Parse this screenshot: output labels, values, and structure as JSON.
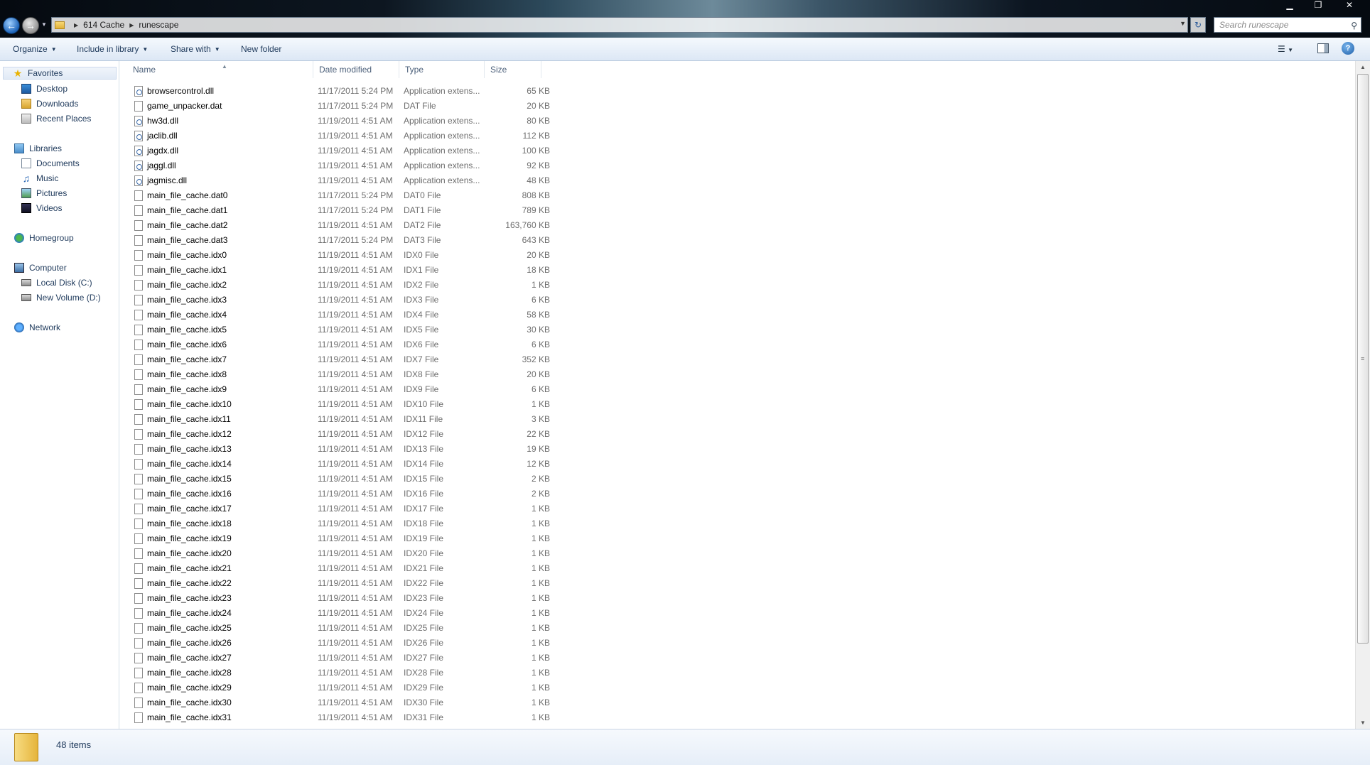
{
  "window": {
    "minimize_glyph": "▁",
    "restore_glyph": "❐",
    "close_glyph": "✕"
  },
  "address": {
    "crumbs": [
      "614 Cache",
      "runescape"
    ]
  },
  "search": {
    "placeholder": "Search runescape"
  },
  "toolbar": {
    "organize": "Organize",
    "include_in_library": "Include in library",
    "share_with": "Share with",
    "new_folder": "New folder"
  },
  "nav": {
    "favorites": "Favorites",
    "desktop": "Desktop",
    "downloads": "Downloads",
    "recent_places": "Recent Places",
    "libraries": "Libraries",
    "documents": "Documents",
    "music": "Music",
    "pictures": "Pictures",
    "videos": "Videos",
    "homegroup": "Homegroup",
    "computer": "Computer",
    "local_disk": "Local Disk (C:)",
    "new_volume": "New Volume (D:)",
    "network": "Network"
  },
  "columns": {
    "name": "Name",
    "date_modified": "Date modified",
    "type": "Type",
    "size": "Size"
  },
  "files": [
    {
      "name": "browsercontrol.dll",
      "date": "11/17/2011 5:24 PM",
      "type": "Application extens...",
      "size": "65 KB",
      "icon": "dll"
    },
    {
      "name": "game_unpacker.dat",
      "date": "11/17/2011 5:24 PM",
      "type": "DAT File",
      "size": "20 KB",
      "icon": "file"
    },
    {
      "name": "hw3d.dll",
      "date": "11/19/2011 4:51 AM",
      "type": "Application extens...",
      "size": "80 KB",
      "icon": "dll"
    },
    {
      "name": "jaclib.dll",
      "date": "11/19/2011 4:51 AM",
      "type": "Application extens...",
      "size": "112 KB",
      "icon": "dll"
    },
    {
      "name": "jagdx.dll",
      "date": "11/19/2011 4:51 AM",
      "type": "Application extens...",
      "size": "100 KB",
      "icon": "dll"
    },
    {
      "name": "jaggl.dll",
      "date": "11/19/2011 4:51 AM",
      "type": "Application extens...",
      "size": "92 KB",
      "icon": "dll"
    },
    {
      "name": "jagmisc.dll",
      "date": "11/19/2011 4:51 AM",
      "type": "Application extens...",
      "size": "48 KB",
      "icon": "dll"
    },
    {
      "name": "main_file_cache.dat0",
      "date": "11/17/2011 5:24 PM",
      "type": "DAT0 File",
      "size": "808 KB",
      "icon": "file"
    },
    {
      "name": "main_file_cache.dat1",
      "date": "11/17/2011 5:24 PM",
      "type": "DAT1 File",
      "size": "789 KB",
      "icon": "file"
    },
    {
      "name": "main_file_cache.dat2",
      "date": "11/19/2011 4:51 AM",
      "type": "DAT2 File",
      "size": "163,760 KB",
      "icon": "file"
    },
    {
      "name": "main_file_cache.dat3",
      "date": "11/17/2011 5:24 PM",
      "type": "DAT3 File",
      "size": "643 KB",
      "icon": "file"
    },
    {
      "name": "main_file_cache.idx0",
      "date": "11/19/2011 4:51 AM",
      "type": "IDX0 File",
      "size": "20 KB",
      "icon": "file"
    },
    {
      "name": "main_file_cache.idx1",
      "date": "11/19/2011 4:51 AM",
      "type": "IDX1 File",
      "size": "18 KB",
      "icon": "file"
    },
    {
      "name": "main_file_cache.idx2",
      "date": "11/19/2011 4:51 AM",
      "type": "IDX2 File",
      "size": "1 KB",
      "icon": "file"
    },
    {
      "name": "main_file_cache.idx3",
      "date": "11/19/2011 4:51 AM",
      "type": "IDX3 File",
      "size": "6 KB",
      "icon": "file"
    },
    {
      "name": "main_file_cache.idx4",
      "date": "11/19/2011 4:51 AM",
      "type": "IDX4 File",
      "size": "58 KB",
      "icon": "file"
    },
    {
      "name": "main_file_cache.idx5",
      "date": "11/19/2011 4:51 AM",
      "type": "IDX5 File",
      "size": "30 KB",
      "icon": "file"
    },
    {
      "name": "main_file_cache.idx6",
      "date": "11/19/2011 4:51 AM",
      "type": "IDX6 File",
      "size": "6 KB",
      "icon": "file"
    },
    {
      "name": "main_file_cache.idx7",
      "date": "11/19/2011 4:51 AM",
      "type": "IDX7 File",
      "size": "352 KB",
      "icon": "file"
    },
    {
      "name": "main_file_cache.idx8",
      "date": "11/19/2011 4:51 AM",
      "type": "IDX8 File",
      "size": "20 KB",
      "icon": "file"
    },
    {
      "name": "main_file_cache.idx9",
      "date": "11/19/2011 4:51 AM",
      "type": "IDX9 File",
      "size": "6 KB",
      "icon": "file"
    },
    {
      "name": "main_file_cache.idx10",
      "date": "11/19/2011 4:51 AM",
      "type": "IDX10 File",
      "size": "1 KB",
      "icon": "file"
    },
    {
      "name": "main_file_cache.idx11",
      "date": "11/19/2011 4:51 AM",
      "type": "IDX11 File",
      "size": "3 KB",
      "icon": "file"
    },
    {
      "name": "main_file_cache.idx12",
      "date": "11/19/2011 4:51 AM",
      "type": "IDX12 File",
      "size": "22 KB",
      "icon": "file"
    },
    {
      "name": "main_file_cache.idx13",
      "date": "11/19/2011 4:51 AM",
      "type": "IDX13 File",
      "size": "19 KB",
      "icon": "file"
    },
    {
      "name": "main_file_cache.idx14",
      "date": "11/19/2011 4:51 AM",
      "type": "IDX14 File",
      "size": "12 KB",
      "icon": "file"
    },
    {
      "name": "main_file_cache.idx15",
      "date": "11/19/2011 4:51 AM",
      "type": "IDX15 File",
      "size": "2 KB",
      "icon": "file"
    },
    {
      "name": "main_file_cache.idx16",
      "date": "11/19/2011 4:51 AM",
      "type": "IDX16 File",
      "size": "2 KB",
      "icon": "file"
    },
    {
      "name": "main_file_cache.idx17",
      "date": "11/19/2011 4:51 AM",
      "type": "IDX17 File",
      "size": "1 KB",
      "icon": "file"
    },
    {
      "name": "main_file_cache.idx18",
      "date": "11/19/2011 4:51 AM",
      "type": "IDX18 File",
      "size": "1 KB",
      "icon": "file"
    },
    {
      "name": "main_file_cache.idx19",
      "date": "11/19/2011 4:51 AM",
      "type": "IDX19 File",
      "size": "1 KB",
      "icon": "file"
    },
    {
      "name": "main_file_cache.idx20",
      "date": "11/19/2011 4:51 AM",
      "type": "IDX20 File",
      "size": "1 KB",
      "icon": "file"
    },
    {
      "name": "main_file_cache.idx21",
      "date": "11/19/2011 4:51 AM",
      "type": "IDX21 File",
      "size": "1 KB",
      "icon": "file"
    },
    {
      "name": "main_file_cache.idx22",
      "date": "11/19/2011 4:51 AM",
      "type": "IDX22 File",
      "size": "1 KB",
      "icon": "file"
    },
    {
      "name": "main_file_cache.idx23",
      "date": "11/19/2011 4:51 AM",
      "type": "IDX23 File",
      "size": "1 KB",
      "icon": "file"
    },
    {
      "name": "main_file_cache.idx24",
      "date": "11/19/2011 4:51 AM",
      "type": "IDX24 File",
      "size": "1 KB",
      "icon": "file"
    },
    {
      "name": "main_file_cache.idx25",
      "date": "11/19/2011 4:51 AM",
      "type": "IDX25 File",
      "size": "1 KB",
      "icon": "file"
    },
    {
      "name": "main_file_cache.idx26",
      "date": "11/19/2011 4:51 AM",
      "type": "IDX26 File",
      "size": "1 KB",
      "icon": "file"
    },
    {
      "name": "main_file_cache.idx27",
      "date": "11/19/2011 4:51 AM",
      "type": "IDX27 File",
      "size": "1 KB",
      "icon": "file"
    },
    {
      "name": "main_file_cache.idx28",
      "date": "11/19/2011 4:51 AM",
      "type": "IDX28 File",
      "size": "1 KB",
      "icon": "file"
    },
    {
      "name": "main_file_cache.idx29",
      "date": "11/19/2011 4:51 AM",
      "type": "IDX29 File",
      "size": "1 KB",
      "icon": "file"
    },
    {
      "name": "main_file_cache.idx30",
      "date": "11/19/2011 4:51 AM",
      "type": "IDX30 File",
      "size": "1 KB",
      "icon": "file"
    },
    {
      "name": "main_file_cache.idx31",
      "date": "11/19/2011 4:51 AM",
      "type": "IDX31 File",
      "size": "1 KB",
      "icon": "file"
    }
  ],
  "status": {
    "item_count": "48 items"
  },
  "colors": {
    "text": "#1e395b",
    "accent": "#3399ff"
  }
}
